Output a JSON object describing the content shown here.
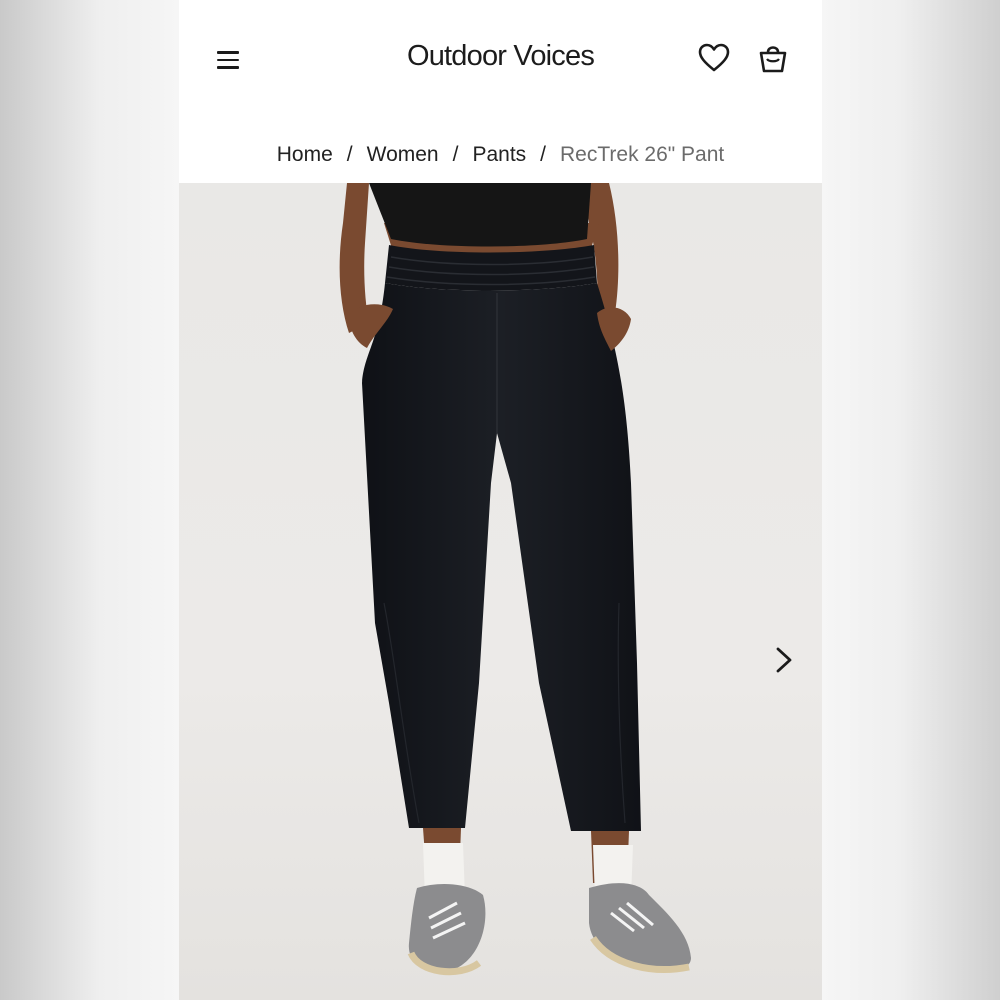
{
  "header": {
    "brand": "Outdoor Voices",
    "menu_icon": "hamburger-menu-icon",
    "wishlist_icon": "heart-icon",
    "bag_icon": "shopping-bag-icon"
  },
  "breadcrumb": {
    "items": [
      "Home",
      "Women",
      "Pants"
    ],
    "separator": "/",
    "current": "RecTrek 26\" Pant"
  },
  "gallery": {
    "next_icon": "chevron-right-icon"
  },
  "colors": {
    "pants": "#15171c",
    "top": "#151515",
    "skin": "#7a4a30",
    "socks": "#f3f2ef",
    "shoes": "#8c8c8e"
  }
}
